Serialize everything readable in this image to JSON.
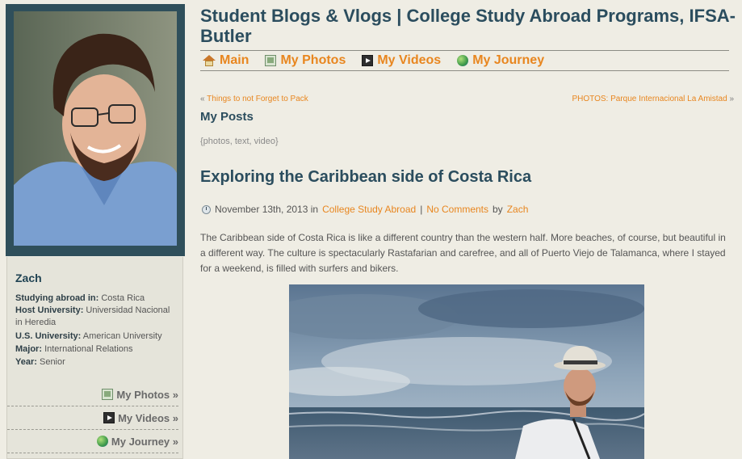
{
  "site": {
    "title": "Student Blogs & Vlogs | College Study Abroad Programs, IFSA-Butler"
  },
  "nav": [
    {
      "label": "Main",
      "icon": "home-icon"
    },
    {
      "label": "My Photos",
      "icon": "photos-icon"
    },
    {
      "label": "My Videos",
      "icon": "videos-icon"
    },
    {
      "label": "My Journey",
      "icon": "globe-icon"
    }
  ],
  "profile": {
    "name": "Zach",
    "fields": [
      {
        "label": "Studying abroad in:",
        "value": "Costa Rica"
      },
      {
        "label": "Host University:",
        "value": "Universidad Nacional in Heredia"
      },
      {
        "label": "U.S. University:",
        "value": "American University"
      },
      {
        "label": "Major:",
        "value": "International Relations"
      },
      {
        "label": "Year:",
        "value": "Senior"
      }
    ],
    "links": [
      {
        "label": "My Photos »",
        "icon": "photos-icon"
      },
      {
        "label": "My Videos »",
        "icon": "videos-icon"
      },
      {
        "label": "My Journey »",
        "icon": "globe-icon"
      }
    ]
  },
  "post_nav": {
    "prev_mark": "«",
    "prev_label": "Things to not Forget to Pack",
    "next_label": "PHOTOS: Parque Internacional La Amistad",
    "next_mark": "»"
  },
  "section": {
    "heading": "My Posts",
    "tagline": "{photos, text, video}"
  },
  "post": {
    "title": "Exploring the Caribbean side of Costa Rica",
    "date": "November 13th, 2013 in",
    "category": "College Study Abroad",
    "separator": "|",
    "comments": "No Comments",
    "by": "by",
    "author": "Zach",
    "excerpt": "The Caribbean side of Costa Rica is like a different country than the western half. More beaches, of course, but beautiful in a different way. The culture is spectacularly Rastafarian and carefree, and all of Puerto Viejo de Talamanca, where I stayed for a weekend, is filled with surfers and bikers."
  },
  "colors": {
    "accent": "#e8861f",
    "heading": "#2b4d5e",
    "background": "#efede4",
    "frame": "#2f4f5b"
  }
}
